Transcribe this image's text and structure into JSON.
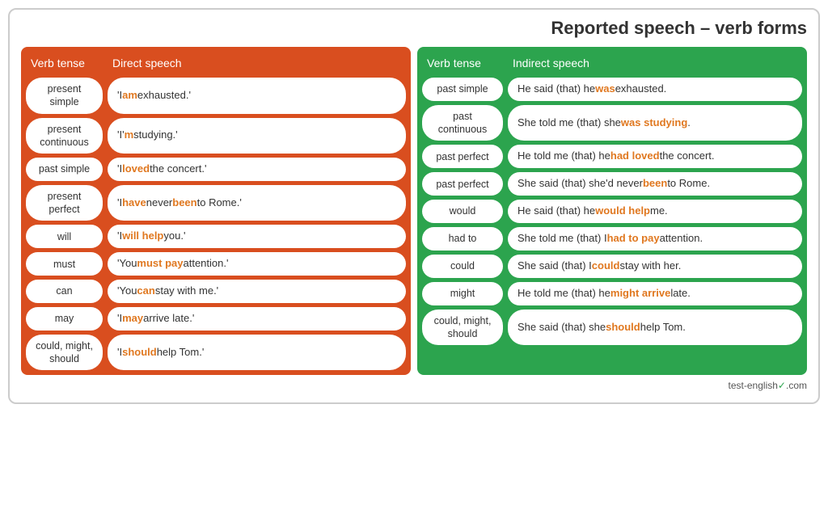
{
  "title": {
    "prefix": "Reported speech",
    "suffix": " – verb forms"
  },
  "left_table": {
    "headers": [
      "Verb tense",
      "Direct speech"
    ],
    "rows": [
      {
        "tense": "present simple",
        "speech_html": "'I <span class=\"orange\">am</span> exhausted.'"
      },
      {
        "tense": "present continuous",
        "speech_html": "'I'<span class=\"orange\">m</span> studying.'"
      },
      {
        "tense": "past simple",
        "speech_html": "'I <span class=\"orange\">loved</span> the concert.'"
      },
      {
        "tense": "present perfect",
        "speech_html": "'I <span class=\"orange\">have</span> never <span class=\"orange\">been</span> to Rome.'"
      },
      {
        "tense": "will",
        "speech_html": "'I <span class=\"orange\">will help</span> you.'"
      },
      {
        "tense": "must",
        "speech_html": "'You <span class=\"orange\">must pay</span> attention.'"
      },
      {
        "tense": "can",
        "speech_html": "'You <span class=\"orange\">can</span> stay with me.'"
      },
      {
        "tense": "may",
        "speech_html": "'I <span class=\"orange\">may</span> arrive late.'"
      },
      {
        "tense": "could, might, should",
        "speech_html": "'I <span class=\"orange\">should</span> help Tom.'"
      }
    ]
  },
  "right_table": {
    "headers": [
      "Verb tense",
      "Indirect speech"
    ],
    "rows": [
      {
        "tense": "past simple",
        "speech_html": "He said (that) he <span class=\"orange\">was</span> exhausted."
      },
      {
        "tense": "past continuous",
        "speech_html": "She told me (that) she <span class=\"orange\">was studying</span>."
      },
      {
        "tense": "past perfect",
        "speech_html": "He told me (that) he <span class=\"orange\">had loved</span> the concert."
      },
      {
        "tense": "past perfect",
        "speech_html": "She said (that) she'd never <span class=\"orange\">been</span> to Rome."
      },
      {
        "tense": "would",
        "speech_html": "He said (that) he <span class=\"orange\">would help</span> me."
      },
      {
        "tense": "had to",
        "speech_html": "She told me (that) I <span class=\"orange\">had to pay</span> attention."
      },
      {
        "tense": "could",
        "speech_html": "She said (that) I <span class=\"orange\">could</span> stay with her."
      },
      {
        "tense": "might",
        "speech_html": "He told me (that) he <span class=\"orange\">might arrive</span> late."
      },
      {
        "tense": "could, might, should",
        "speech_html": "She said (that) she <span class=\"orange\">should</span> help Tom."
      }
    ]
  },
  "footer": {
    "text": "test-english",
    "suffix": ".com"
  }
}
